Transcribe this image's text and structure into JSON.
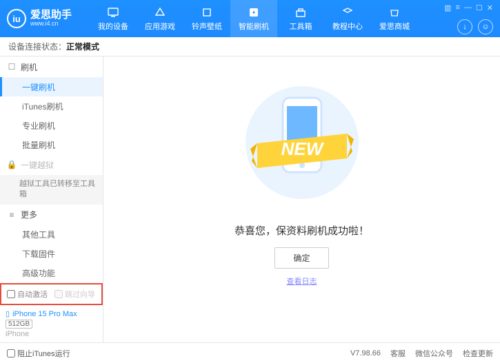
{
  "app": {
    "name_cn": "爱思助手",
    "name_en": "www.i4.cn",
    "logo": "iu"
  },
  "topnav": [
    {
      "label": "我的设备"
    },
    {
      "label": "应用游戏"
    },
    {
      "label": "铃声壁纸"
    },
    {
      "label": "智能刷机",
      "active": true
    },
    {
      "label": "工具箱"
    },
    {
      "label": "教程中心"
    },
    {
      "label": "爱思商城"
    }
  ],
  "status": {
    "prefix": "设备连接状态：",
    "value": "正常模式"
  },
  "sidebar": {
    "group1": {
      "icon": "☐",
      "label": "刷机"
    },
    "items1": [
      {
        "label": "一键刷机",
        "active": true
      },
      {
        "label": "iTunes刷机"
      },
      {
        "label": "专业刷机"
      },
      {
        "label": "批量刷机"
      }
    ],
    "group2": {
      "icon": "🔒",
      "label": "一键越狱",
      "muted": true
    },
    "sub2": "越狱工具已转移至工具箱",
    "group3": {
      "icon": "≡",
      "label": "更多"
    },
    "items3": [
      {
        "label": "其他工具"
      },
      {
        "label": "下载固件"
      },
      {
        "label": "高级功能"
      }
    ],
    "checkboxes": {
      "auto_activate": "自动激活",
      "skip_guide": "跳过向导"
    },
    "device": {
      "name": "iPhone 15 Pro Max",
      "storage": "512GB",
      "type": "iPhone"
    }
  },
  "main": {
    "banner": "NEW",
    "success_text": "恭喜您，保资料刷机成功啦！",
    "ok_label": "确定",
    "log_link": "查看日志"
  },
  "footer": {
    "block_itunes": "阻止iTunes运行",
    "version": "V7.98.66",
    "links": [
      "客服",
      "微信公众号",
      "检查更新"
    ]
  }
}
